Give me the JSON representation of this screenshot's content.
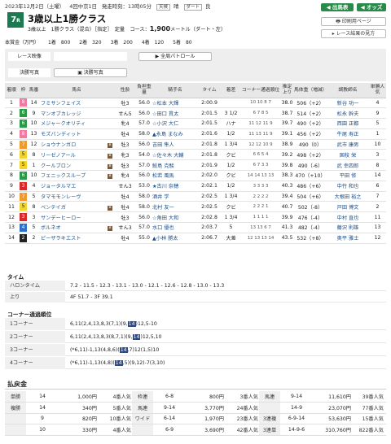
{
  "header": {
    "date": "2023年12月2日（土曜）",
    "meeting": "4回中京1日",
    "post_time_label": "発走時刻：",
    "post_time": "13時05分",
    "turf": "芝",
    "dirt": "ダート",
    "going": "良",
    "cond_tag": "天候",
    "weather": "晴"
  },
  "race": {
    "number": "7",
    "number_suffix": "R",
    "title": "3歳以上1勝クラス",
    "conditions": "3歳以上　1勝クラス（混合）［指定］　定量",
    "course_label": "コース：",
    "distance": "1,900",
    "course_detail": "メートル（ダート・左）"
  },
  "buttons": {
    "results": "出馬表",
    "odds": "オッズ",
    "print": "印刷用ページ",
    "list": "レース結果の見方"
  },
  "prize": {
    "label": "本賞金（万円）",
    "items": [
      "1着　800",
      "2着　320",
      "3着　200",
      "4着　120",
      "5着　80"
    ]
  },
  "media": {
    "video_label": "レース映像",
    "play": "PLAY",
    "patrol": "全周パトロール",
    "finish_label": "決勝写真",
    "finish_btn": "決勝写真"
  },
  "table": {
    "headers": [
      "着順",
      "枠",
      "馬番",
      "馬名",
      "性齢",
      "負担重量",
      "騎手名",
      "タイム",
      "着差",
      "コーナー通過順位",
      "推定上り",
      "馬体重（増減）",
      "調教師名",
      "単勝人気"
    ],
    "rows": [
      [
        "1",
        "8",
        "14",
        "フミサンフェイス",
        "",
        "牡3",
        "56.0",
        "☆松本 大輝",
        "2:00.9",
        "",
        "10 10 8 7",
        "38.0",
        "506（+2）",
        "新谷 功一",
        "4"
      ],
      [
        "2",
        "6",
        "9",
        "マンオブカレッジ",
        "",
        "せん5",
        "56.0",
        "☆田口 貫太",
        "2:01.5",
        "3 1/2",
        "6 7 8 5",
        "38.7",
        "514（+2）",
        "松永 幹夫",
        "9"
      ],
      [
        "3",
        "6",
        "10",
        "メジャークオリティ",
        "",
        "牝4",
        "57.0",
        "☆小沢 大仁",
        "2:01.5",
        "ハナ",
        "11 12 11 9",
        "39.7",
        "490（+2）",
        "西園 正都",
        "5"
      ],
      [
        "4",
        "8",
        "13",
        "モズバンディット",
        "",
        "牡4",
        "58.0",
        "▲永島 まなみ",
        "2:01.6",
        "1/2",
        "11 13 11 9",
        "39.1",
        "456（+2）",
        "牛尾 寿正",
        "1"
      ],
      [
        "5",
        "7",
        "12",
        "ショウナンガロ",
        "B",
        "牡3",
        "56.0",
        "吉田 隼人",
        "2:01.8",
        "1 3/4",
        "12 12 10 9",
        "38.9",
        "490（0）",
        "武市 康男",
        "10"
      ],
      [
        "6",
        "5",
        "8",
        "リーゼノアール",
        "B",
        "牝3",
        "54.0",
        "☆佐々木 大輔",
        "2:01.8",
        "クビ",
        "6 6 5 4",
        "39.2",
        "498（+2）",
        "国枝 栄",
        "3"
      ],
      [
        "7",
        "5",
        "1",
        "クールブロン",
        "B",
        "牡3",
        "57.0",
        "鮫島 克駿",
        "2:01.9",
        "1/2",
        "6 7 3 3",
        "39.8",
        "490（-6）",
        "武 幸四郎",
        "8"
      ],
      [
        "8",
        "6",
        "10",
        "フェニックスループ",
        "B",
        "牝4",
        "56.0",
        "松若 風馬",
        "2:02.0",
        "クビ",
        "14 14 13 13",
        "38.3",
        "470（+10）",
        "平田 修",
        "14"
      ],
      [
        "9",
        "3",
        "4",
        "ジョータルマエ",
        "",
        "せん3",
        "53.0",
        "★古川 奈穂",
        "2:02.1",
        "1/2",
        "3 3 3 3",
        "40.3",
        "486（+6）",
        "中竹 和也",
        "6"
      ],
      [
        "10",
        "7",
        "5",
        "タマモモンレーヴ",
        "",
        "牡4",
        "58.0",
        "酒井 学",
        "2:02.5",
        "1 3/4",
        "2 2 2 2",
        "39.4",
        "504（+6）",
        "大根田 裕之",
        "7"
      ],
      [
        "11",
        "5",
        "8",
        "ベンテイガ",
        "B",
        "牡4",
        "58.0",
        "北村 友一",
        "2:02.5",
        "クビ",
        "2 2 2 1",
        "40.7",
        "502（-8）",
        "戸田 博文",
        "2"
      ],
      [
        "12",
        "3",
        "3",
        "サンデーヒーロー",
        "",
        "牡3",
        "56.0",
        "☆角田 大和",
        "2:02.8",
        "1 3/4",
        "1 1 1 1",
        "39.9",
        "476（-4）",
        "中村 直也",
        "11"
      ],
      [
        "13",
        "4",
        "5",
        "ボルネオ",
        "B",
        "せん3",
        "57.0",
        "水口 優也",
        "2:03.7",
        "5",
        "13 13 6 7",
        "41.3",
        "482（-4）",
        "藤沢 則雄",
        "13"
      ],
      [
        "14",
        "2",
        "2",
        "ピーザラキエスト",
        "",
        "牡4",
        "55.0",
        "▲小林 勝太",
        "2:06.7",
        "大差",
        "12 13 13 14",
        "43.5",
        "532（+8）",
        "奥平 雅士",
        "12"
      ]
    ]
  },
  "laps": {
    "section": "タイム",
    "haron_label": "ハロンタイム",
    "haron": "7.2 - 11.5 - 12.3 - 13.1 - 13.0 - 12.1 - 12.6 - 12.8 - 13.0 - 13.3",
    "agari_label": "上り",
    "agari": "4F 51.7 - 3F 39.1"
  },
  "corners": {
    "section": "コーナー通過順位",
    "rows": [
      {
        "label": "1コーナー",
        "pre": "6,11(2,4,13,8,3(7,1)(9,",
        "hl": "14",
        "post": ")12,5-10"
      },
      {
        "label": "2コーナー",
        "pre": "6,11(2,4,13,8,3(8,7,1)(9,",
        "hl": "14",
        "post": ")12,5,10"
      },
      {
        "label": "3コーナー",
        "pre": "(*6,11)-1,13(4,8,6)(",
        "hl": "14",
        "post": ",7)12(1,5)10"
      },
      {
        "label": "4コーナー",
        "pre": "(*6,11)-1,13(4,8)(",
        "hl": "14",
        "post": ",5)(9,12)-7(3,10)"
      }
    ]
  },
  "payout": {
    "section": "払戻金",
    "left": [
      [
        "単勝",
        "14",
        "1,000円",
        "4番人気"
      ],
      [
        "複勝",
        "14",
        "340円",
        "5番人気"
      ],
      [
        "",
        "9",
        "820円",
        "10番人気"
      ],
      [
        "",
        "10",
        "330円",
        "4番人気"
      ]
    ],
    "mid": [
      [
        "枠連",
        "6-8",
        "800円",
        "3番人気"
      ],
      [
        "馬連",
        "9-14",
        "3,770円",
        "24番人気"
      ],
      [
        "ワイド",
        "6-14",
        "1,970円",
        "23番人気"
      ],
      [
        "",
        "6-9",
        "3,690円",
        "42番人気"
      ]
    ],
    "right": [
      [
        "馬連",
        "9-14",
        "11,610円",
        "39番人気"
      ],
      [
        "",
        "14-9",
        "23,070円",
        "77番人気"
      ],
      [
        "3連複",
        "6-9-14",
        "53,630円",
        "15番人気"
      ],
      [
        "3連単",
        "14-9-6",
        "310,760円",
        "822番人気"
      ]
    ]
  },
  "colors": {
    "accent": "#2a8a4a",
    "badge": "#1b7a50",
    "highlight": "#2c4b8a"
  }
}
